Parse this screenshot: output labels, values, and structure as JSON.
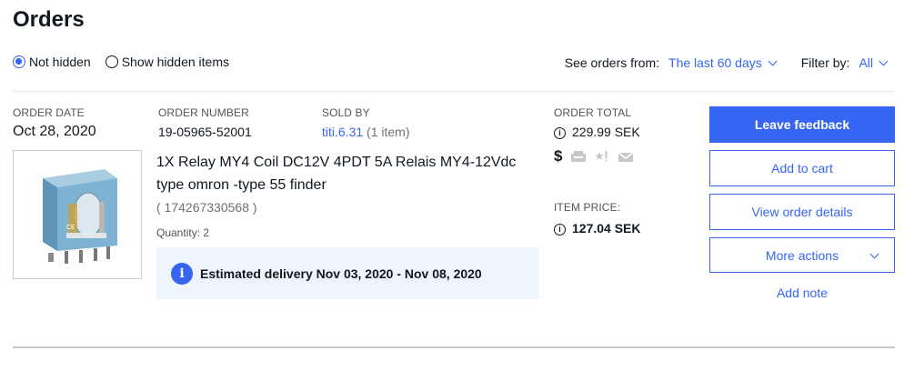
{
  "page": {
    "title": "Orders"
  },
  "visibility": {
    "options": [
      {
        "label": "Not hidden",
        "checked": true
      },
      {
        "label": "Show hidden items",
        "checked": false
      }
    ]
  },
  "filters": {
    "see_orders_label": "See orders from:",
    "see_orders_value": "The last 60 days",
    "filter_by_label": "Filter by:",
    "filter_by_value": "All"
  },
  "order": {
    "date_label": "ORDER DATE",
    "date": "Oct 28, 2020",
    "number_label": "ORDER NUMBER",
    "number": "19-05965-52001",
    "sold_by_label": "SOLD BY",
    "seller": "titi.6.31",
    "item_count": "(1 item)",
    "total_label": "ORDER TOTAL",
    "total": "229.99 SEK",
    "item_price_label": "ITEM PRICE:",
    "item_price": "127.04 SEK",
    "item": {
      "title": "1X Relay MY4 Coil DC12V 4PDT 5A Relais MY4-12Vdc type omron -type 55 finder",
      "id": "( 174267330568 )",
      "quantity": "Quantity: 2"
    },
    "delivery": "Estimated delivery Nov 03, 2020 - Nov 08, 2020"
  },
  "actions": {
    "leave_feedback": "Leave feedback",
    "add_to_cart": "Add to cart",
    "view_order_details": "View order details",
    "more_actions": "More actions",
    "add_note": "Add note"
  },
  "icons": {
    "info": "info-icon",
    "dollar": "dollar-icon",
    "shipped": "shipped-icon",
    "feedback": "feedback-star-icon",
    "message": "envelope-icon"
  },
  "colors": {
    "accent": "#3665f3",
    "delivery_bg": "#eef5fc"
  }
}
